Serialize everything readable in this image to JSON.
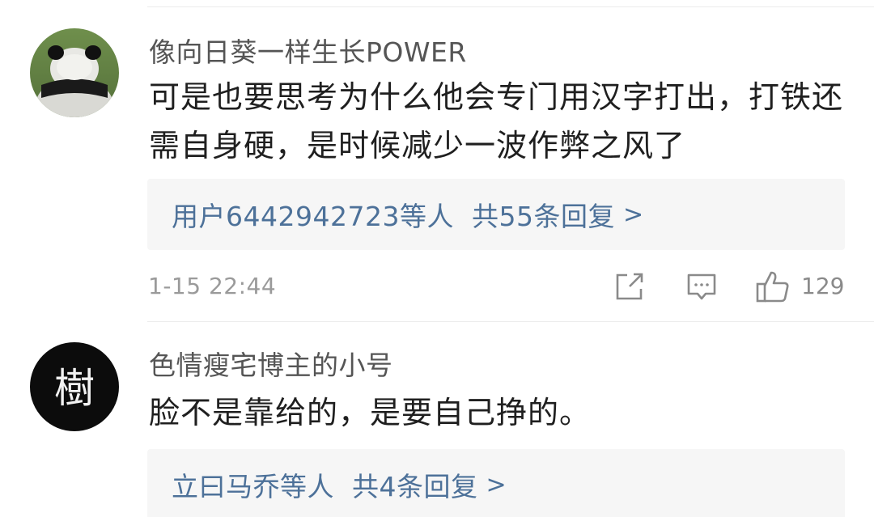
{
  "comments": [
    {
      "username": "像向日葵一样生长POWER",
      "text": "可是也要思考为什么他会专门用汉字打出，打铁还需自身硬，是时候减少一波作弊之风了",
      "reply_users": "用户6442942723等人",
      "reply_count": "共55条回复",
      "reply_chevron": ">",
      "timestamp": "1-15 22:44",
      "like_count": "129",
      "avatar_icon": "panda-avatar"
    },
    {
      "username": "色情瘦宅博主的小号",
      "text": "脸不是靠给的，是要自己挣的。",
      "reply_users": "立曰马乔等人",
      "reply_count": "共4条回复",
      "reply_chevron": ">",
      "avatar_icon": "calligraphy-avatar",
      "avatar_text": "樹"
    }
  ],
  "colors": {
    "link": "#4d7199",
    "text": "#1f1f1f",
    "username": "#555555",
    "meta": "#9a9a9a",
    "reply_bg": "#f6f6f6"
  },
  "icons": [
    "share-icon",
    "comment-icon",
    "thumbs-up-icon"
  ]
}
